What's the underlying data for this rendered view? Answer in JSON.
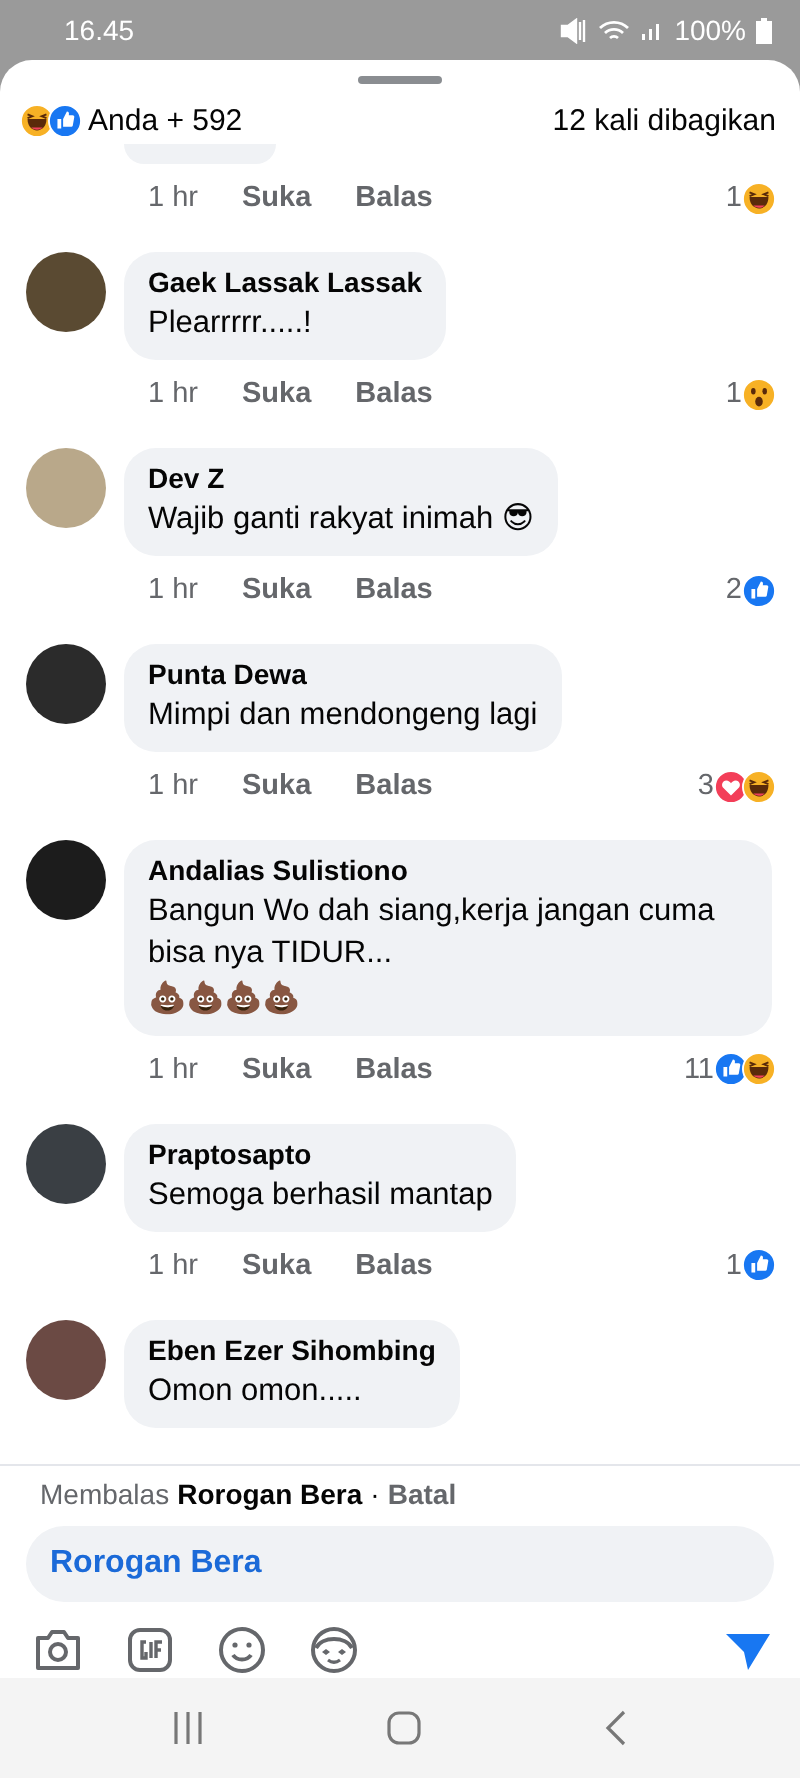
{
  "status_bar": {
    "time": "16.45",
    "battery": "100%"
  },
  "header": {
    "reactions": [
      {
        "kind": "haha"
      },
      {
        "kind": "like"
      }
    ],
    "reactors": "Anda + 592",
    "shares": "12 kali dibagikan"
  },
  "partial_comment": {
    "time": "1 hr",
    "like": "Suka",
    "reply": "Balas",
    "reaction_count": "1",
    "reactions": [
      {
        "kind": "haha"
      }
    ]
  },
  "comments": [
    {
      "author": "Gaek Lassak Lassak",
      "text": "Plearrrrr.....!",
      "time": "1 hr",
      "like": "Suka",
      "reply": "Balas",
      "reaction_count": "1",
      "reactions": [
        {
          "kind": "wow"
        }
      ]
    },
    {
      "author": "Dev Z",
      "text": "Wajib ganti rakyat inimah 😎",
      "time": "1 hr",
      "like": "Suka",
      "reply": "Balas",
      "reaction_count": "2",
      "reactions": [
        {
          "kind": "like"
        }
      ]
    },
    {
      "author": "Punta Dewa",
      "text": "Mimpi dan mendongeng lagi",
      "time": "1 hr",
      "like": "Suka",
      "reply": "Balas",
      "reaction_count": "3",
      "reactions": [
        {
          "kind": "love"
        },
        {
          "kind": "haha"
        }
      ]
    },
    {
      "author": "Andalias Sulistiono",
      "text": "Bangun Wo dah siang,kerja jangan cuma bisa nya TIDUR...",
      "extra": "💩💩💩💩",
      "time": "1 hr",
      "like": "Suka",
      "reply": "Balas",
      "reaction_count": "11",
      "reactions": [
        {
          "kind": "like"
        },
        {
          "kind": "haha"
        }
      ]
    },
    {
      "author": "Praptosapto",
      "text": "Semoga berhasil mantap",
      "time": "1 hr",
      "like": "Suka",
      "reply": "Balas",
      "reaction_count": "1",
      "reactions": [
        {
          "kind": "like"
        }
      ]
    },
    {
      "author": "Eben Ezer Sihombing",
      "text": "Omon omon....."
    }
  ],
  "reply_bar": {
    "prefix": "Membalas",
    "name": "Rorogan Bera",
    "separator": "·",
    "cancel": "Batal"
  },
  "composer": {
    "value": "Rorogan Bera"
  }
}
